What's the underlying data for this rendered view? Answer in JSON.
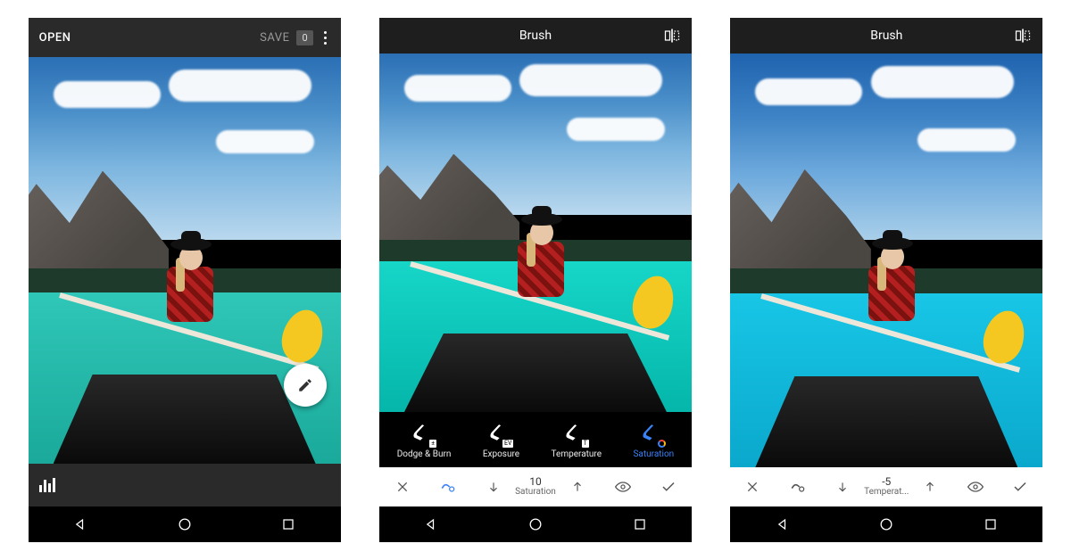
{
  "screen1": {
    "open_label": "OPEN",
    "save_label": "SAVE",
    "edits_badge": "0"
  },
  "screen2": {
    "title": "Brush",
    "tools": [
      {
        "label": "Dodge & Burn",
        "tag": "±"
      },
      {
        "label": "Exposure",
        "tag": "EV"
      },
      {
        "label": "Temperature",
        "tag": "T"
      },
      {
        "label": "Saturation",
        "tag": ""
      }
    ],
    "active_tool_index": 3,
    "value": {
      "number": "10",
      "label": "Saturation"
    }
  },
  "screen3": {
    "title": "Brush",
    "value": {
      "number": "-5",
      "label": "Temperat..."
    }
  }
}
